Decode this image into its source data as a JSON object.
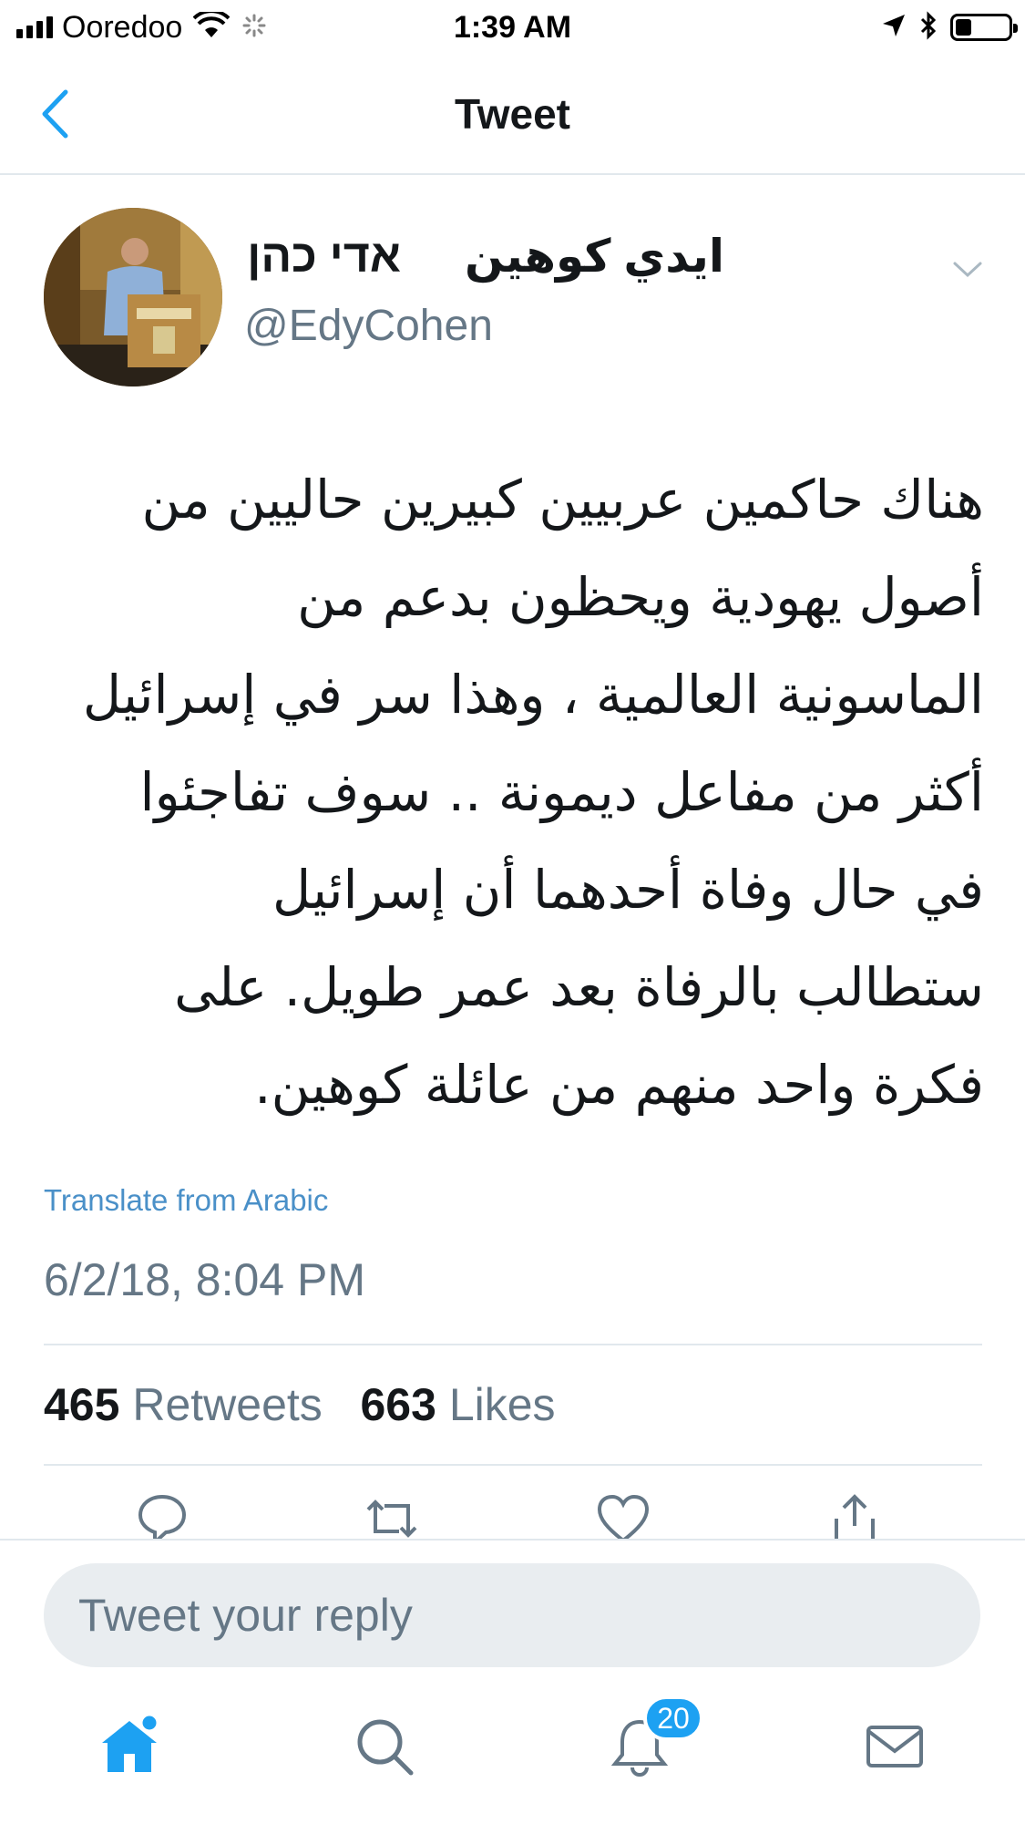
{
  "status_bar": {
    "carrier": "Ooredoo",
    "time": "1:39 AM",
    "battery_level": 0.3,
    "icons": [
      "signal-icon",
      "wifi-icon",
      "activity-spinner-icon",
      "location-arrow-icon",
      "bluetooth-icon",
      "battery-icon"
    ]
  },
  "nav": {
    "title": "Tweet",
    "back_icon": "chevron-left-icon"
  },
  "tweet": {
    "author_name_arabic": "ايدي كوهين",
    "author_name_hebrew": "אדי כהן",
    "handle": "@EdyCohen",
    "text_lines": [
      "هناك حاكمين عربيين كبيرين حاليين من",
      "أصول يهودية ويحظون بدعم من",
      "الماسونية العالمية ، وهذا سر في إسرائيل",
      "أكثر من مفاعل ديمونة .. سوف تفاجئوا",
      "في حال وفاة أحدهما أن إسرائيل",
      "ستطالب بالرفاة بعد عمر طويل. على",
      "فكرة واحد منهم من عائلة كوهين."
    ],
    "translate_label": "Translate from Arabic",
    "timestamp": "6/2/18, 8:04 PM",
    "retweets_count": "465",
    "retweets_label": "Retweets",
    "likes_count": "663",
    "likes_label": "Likes"
  },
  "actions": [
    "reply-icon",
    "retweet-icon",
    "like-icon",
    "share-icon"
  ],
  "composer": {
    "placeholder": "Tweet your reply"
  },
  "tab_bar": {
    "tabs": [
      "home-icon",
      "search-icon",
      "notifications-icon",
      "messages-icon"
    ],
    "notifications_badge": "20"
  },
  "colors": {
    "accent": "#1da1f2",
    "link": "#4a90c8",
    "muted_text": "#657786",
    "divider": "#e1e8ed",
    "input_bg": "#e9edf0"
  }
}
